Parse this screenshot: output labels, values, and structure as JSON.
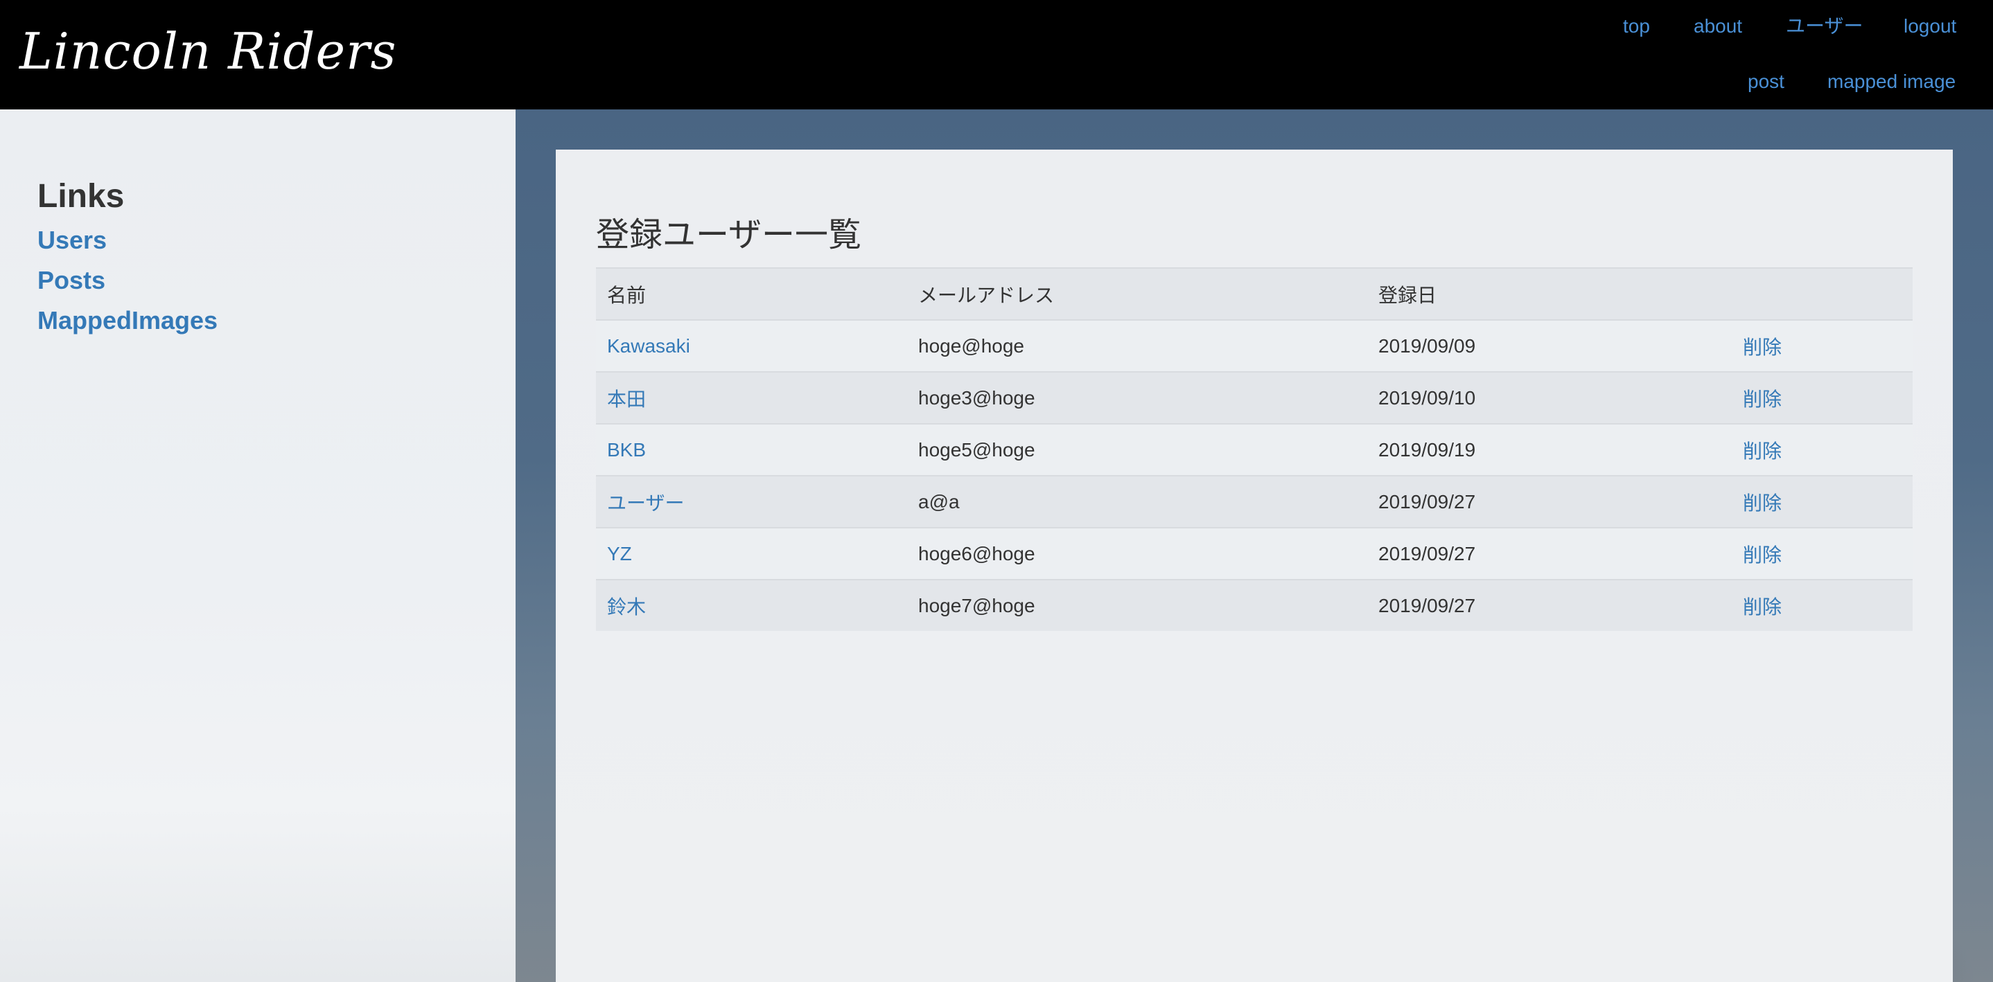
{
  "header": {
    "logo": "Lincoln Riders",
    "nav": {
      "top": "top",
      "about": "about",
      "users": "ユーザー",
      "logout": "logout",
      "post": "post",
      "mapped_image": "mapped image"
    }
  },
  "sidebar": {
    "title": "Links",
    "items": [
      {
        "label": "Users"
      },
      {
        "label": "Posts"
      },
      {
        "label": "MappedImages"
      }
    ]
  },
  "main": {
    "title": "登録ユーザー一覧",
    "columns": [
      "名前",
      "メールアドレス",
      "登録日",
      ""
    ],
    "rows": [
      {
        "name": "Kawasaki",
        "email": "hoge@hoge",
        "date": "2019/09/09",
        "action": "削除"
      },
      {
        "name": "本田",
        "email": "hoge3@hoge",
        "date": "2019/09/10",
        "action": "削除"
      },
      {
        "name": "BKB",
        "email": "hoge5@hoge",
        "date": "2019/09/19",
        "action": "削除"
      },
      {
        "name": "ユーザー",
        "email": "a@a",
        "date": "2019/09/27",
        "action": "削除"
      },
      {
        "name": "YZ",
        "email": "hoge6@hoge",
        "date": "2019/09/27",
        "action": "削除"
      },
      {
        "name": "鈴木",
        "email": "hoge7@hoge",
        "date": "2019/09/27",
        "action": "削除"
      }
    ]
  },
  "colors": {
    "link": "#3479b7",
    "nav_link": "#4a90d6",
    "header_bg": "#000000"
  }
}
